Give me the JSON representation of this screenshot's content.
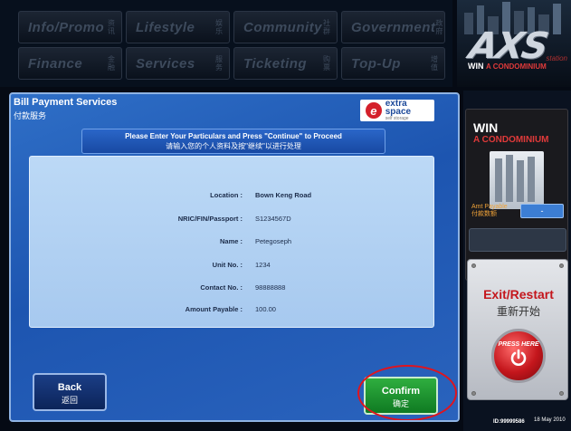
{
  "categories": [
    {
      "label": "Info/Promo",
      "cn": "资讯"
    },
    {
      "label": "Lifestyle",
      "cn": "娱乐"
    },
    {
      "label": "Community",
      "cn": "社群"
    },
    {
      "label": "Government",
      "cn": "政府"
    },
    {
      "label": "Finance",
      "cn": "金融"
    },
    {
      "label": "Services",
      "cn": "服务"
    },
    {
      "label": "Ticketing",
      "cn": "购票"
    },
    {
      "label": "Top-Up",
      "cn": "增值"
    }
  ],
  "brand": {
    "logo": "AXS",
    "station": "station",
    "tagline_win": "WIN",
    "tagline_rest": "A CONDOMINIUM"
  },
  "panel": {
    "title": "Bill Payment Services",
    "title_cn": "付款服务",
    "merchant_name": "extra space",
    "merchant_sub": "self storage",
    "instruction_en": "Please Enter Your Particulars and Press \"Continue\" to Proceed",
    "instruction_cn": "请输入您的个人资料及按\"继续\"以进行处理"
  },
  "details": [
    {
      "label": "Location :",
      "value": "Bown Keng Road",
      "bold": true
    },
    {
      "label": "NRIC/FIN/Passport :",
      "value": "S1234567D",
      "bold": false
    },
    {
      "label": "Name :",
      "value": "Petegoseph",
      "bold": false
    },
    {
      "label": "Unit No. :",
      "value": "1234",
      "bold": false
    },
    {
      "label": "Contact No. :",
      "value": "98888888",
      "bold": false
    },
    {
      "label": "Amount Payable :",
      "value": "100.00",
      "bold": false
    }
  ],
  "buttons": {
    "back_en": "Back",
    "back_cn": "返回",
    "confirm_en": "Confirm",
    "confirm_cn": "确定"
  },
  "sidebar": {
    "promo_win": "WIN",
    "promo_condo": "A CONDOMINIUM",
    "amt_label": "Amt Payable",
    "amt_label_cn": "付款数额",
    "amt_value": "-",
    "exit_label": "Exit/Restart",
    "exit_label_cn": "重新开始",
    "exit_press": "PRESS HERE"
  },
  "footer": {
    "id": "ID:99999586",
    "date": "18 May 2010"
  },
  "colors": {
    "panel_blue": "#1d55b0",
    "confirm_green": "#2fae3f",
    "highlight_red": "#e0141e",
    "exit_red": "#c4161c"
  }
}
